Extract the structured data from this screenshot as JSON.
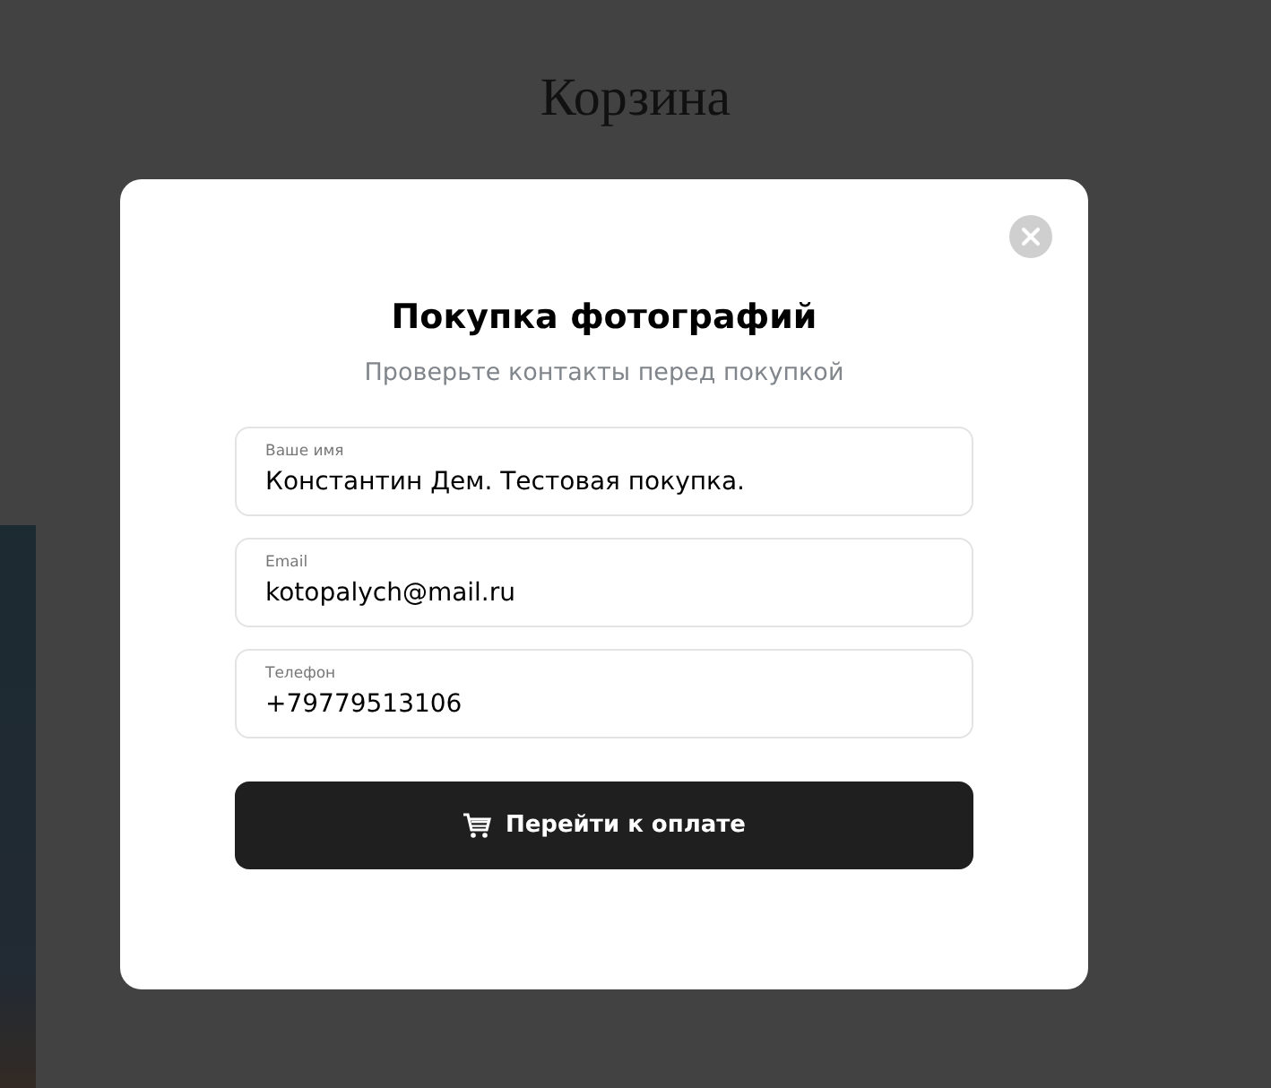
{
  "page": {
    "title": "Корзина"
  },
  "modal": {
    "title": "Покупка фотографий",
    "subtitle": "Проверьте контакты перед покупкой",
    "fields": [
      {
        "label": "Ваше имя",
        "value": "Константин Дем. Тестовая покупка."
      },
      {
        "label": "Email",
        "value": "kotopalych@mail.ru"
      },
      {
        "label": "Телефон",
        "value": "+79779513106"
      }
    ],
    "button": "Перейти к оплате"
  }
}
